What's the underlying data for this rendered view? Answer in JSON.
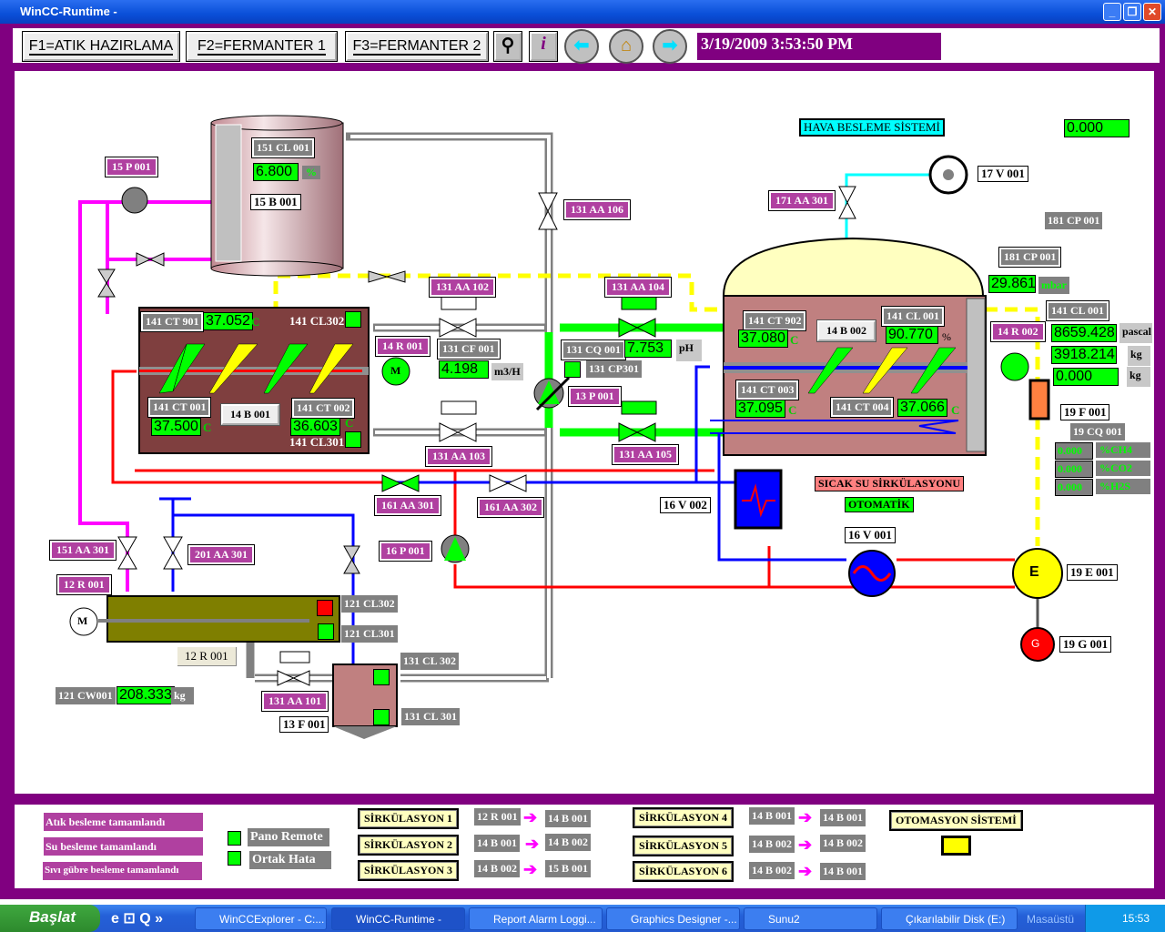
{
  "window": {
    "title": "WinCC-Runtime -",
    "controls": [
      "_",
      "❐",
      "✕"
    ]
  },
  "toolbar": {
    "f1": "F1=ATIK HAZIRLAMA",
    "f2": "F2=FERMANTER 1",
    "f3": "F3=FERMANTER 2",
    "datetime": "3/19/2009 3:53:50 PM",
    "icons": [
      "binoculars-icon",
      "info-icon",
      "back-arrow-icon",
      "home-icon",
      "forward-arrow-icon"
    ]
  },
  "tank15": {
    "p001": "15 P 001",
    "cl001": "151 CL 001",
    "level": "6.800",
    "unit": "%",
    "name": "15 B 001"
  },
  "reactor14b001": {
    "ct901": "141 CT 901",
    "ct901_val": "37.052",
    "cl302": "141 CL302",
    "ct001": "141 CT 001",
    "ct001_val": "37.500",
    "name": "14 B 001",
    "ct002": "141 CT 002",
    "ct002_val": "36.603",
    "cl301": "141 CL301",
    "unit": "C",
    "r001": "14 R 001",
    "motor": "M"
  },
  "middle": {
    "aa106": "131 AA 106",
    "aa102": "131 AA 102",
    "aa104": "131 AA 104",
    "cf001": "131 CF 001",
    "flow": "4.198",
    "flow_unit": "m3/H",
    "cq001": "131 CQ 001",
    "ph": "7.753",
    "ph_unit": "pH",
    "cp301": "131 CP301",
    "p001": "13 P 001",
    "aa103": "131 AA 103",
    "aa105": "131 AA 105",
    "aa301_161": "161 AA 301",
    "aa302_161": "161 AA 302",
    "p001_16": "16 P 001",
    "v002_16": "16 V 002"
  },
  "air": {
    "title": "HAVA BESLEME SİSTEMİ",
    "v001": "17 V 001",
    "aa301": "171 AA 301",
    "value": "0.000",
    "cp001_a": "181 CP 001",
    "cp001_b": "181 CP 001",
    "pressure": "29.861",
    "pressure_unit": "mbar"
  },
  "fermenter": {
    "ct902": "141 CT 902",
    "ct902_val": "37.080",
    "name": "14 B 002",
    "cl001": "141 CL 001",
    "cl001_val": "90.770",
    "pct": "%",
    "ct003": "141 CT 003",
    "ct003_val": "37.095",
    "ct004": "141 CT 004",
    "ct004_val": "37.066",
    "unit": "C",
    "r002": "14 R 002"
  },
  "right": {
    "cl001": "141 CL 001",
    "v1": "8659.428",
    "u1": "pascal",
    "v2": "3918.214",
    "u2": "kg",
    "v3": "0.000",
    "u3": "kg",
    "f001": "19 F 001",
    "cq001": "19 CQ 001",
    "gas": [
      {
        "v": "0.000",
        "u": "%CH4"
      },
      {
        "v": "0.000",
        "u": "%CO2"
      },
      {
        "v": "0.000",
        "u": "%H2S"
      }
    ],
    "sicak": "SICAK SU SİRKÜLASYONU",
    "otomatik": "OTOMATİK",
    "v001_16": "16 V 001",
    "e001": "19 E 001",
    "e_letter": "E",
    "g001": "19 G 001",
    "g_letter": "G"
  },
  "mixer": {
    "aa301_151": "151 AA 301",
    "aa301_201": "201 AA 301",
    "r001": "12 R 001",
    "motor": "M",
    "cl302": "121 CL302",
    "cl301": "121 CL301",
    "r001_btn": "12 R 001",
    "cw001": "121 CW001",
    "weight": "208.333",
    "weight_unit": "kg",
    "aa101": "131 AA 101",
    "f001": "13 F 001",
    "cl302_131": "131 CL 302",
    "cl301_131": "131 CL 301"
  },
  "bottom": {
    "messages": [
      "Atık besleme  tamamlandı",
      "Su besleme  tamamlandı",
      "Sıvı gübre besleme  tamamlandı"
    ],
    "pano": "Pano Remote",
    "ortak": "Ortak Hata",
    "circ": [
      {
        "label": "SİRKÜLASYON 1",
        "from": "12 R 001",
        "to": "14 B 001"
      },
      {
        "label": "SİRKÜLASYON 2",
        "from": "14 B 001",
        "to": "14 B 002"
      },
      {
        "label": "SİRKÜLASYON 3",
        "from": "14 B 002",
        "to": "15 B 001"
      },
      {
        "label": "SİRKÜLASYON 4",
        "from": "14 B 001",
        "to": "14 B 001"
      },
      {
        "label": "SİRKÜLASYON 5",
        "from": "14 B 002",
        "to": "14 B 002"
      },
      {
        "label": "SİRKÜLASYON 6",
        "from": "14 B 002",
        "to": "14 B 001"
      }
    ],
    "otomasyon": "OTOMASYON SİSTEMİ",
    "arrow": "➔"
  },
  "taskbar": {
    "start": "Başlat",
    "tasks": [
      "WinCCExplorer - C:...",
      "WinCC-Runtime -",
      "Report Alarm Loggi...",
      "Graphics Designer -...",
      "Sunu2",
      "Çıkarılabilir Disk (E:)"
    ],
    "desktop": "Masaüstü",
    "time": "15:53"
  },
  "colors": {
    "frame": "#800080",
    "tag": "#b040a0",
    "value": "#00ff00",
    "water": "#0000ff",
    "hot": "#ff0000",
    "feed": "#ff00ff",
    "gas": "#ffff00",
    "air": "#00ffff"
  }
}
